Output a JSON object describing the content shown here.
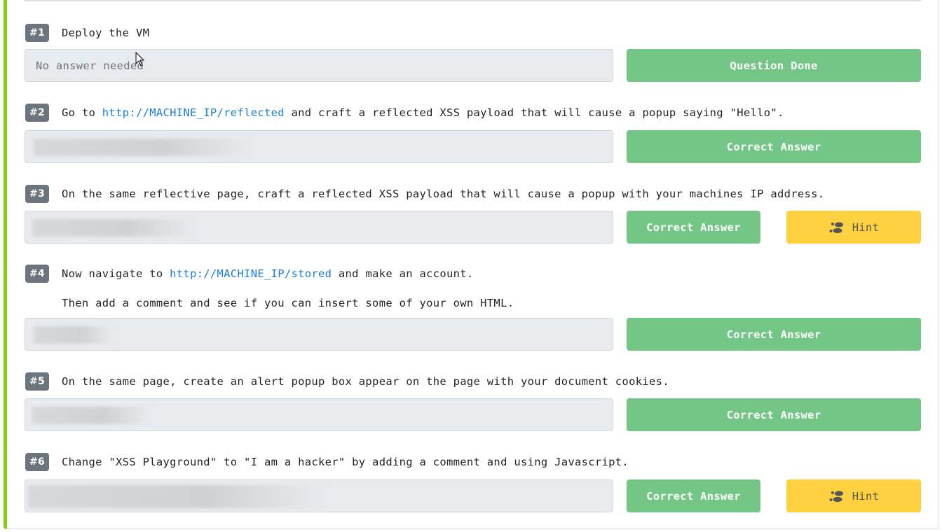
{
  "colors": {
    "accent_border": "#88cc14",
    "badge_bg": "#6c757d",
    "success": "#74c687",
    "hint": "#fdd13f",
    "link": "#1c7dd6",
    "field_bg": "#e7ebee"
  },
  "questions": [
    {
      "number": "#1",
      "text_before": "Deploy the VM",
      "answer": {
        "value": "No answer needed",
        "blurred": false
      },
      "submit_label": "Question Done",
      "hint_label": null
    },
    {
      "number": "#2",
      "text_before": "Go to ",
      "link": "http://MACHINE_IP/reflected",
      "text_after": " and craft a reflected XSS payload that will cause a popup saying \"Hello\".",
      "answer": {
        "value": "",
        "blurred": true
      },
      "submit_label": "Correct Answer",
      "hint_label": null
    },
    {
      "number": "#3",
      "text_before": "On the same reflective page, craft a reflected XSS payload that will cause a popup with your machines IP address.",
      "answer": {
        "value": "",
        "blurred": true
      },
      "submit_label": "Correct Answer",
      "hint_label": "Hint",
      "hint_icon": "footprints-icon"
    },
    {
      "number": "#4",
      "text_before": "Now navigate to ",
      "link": "http://MACHINE_IP/stored",
      "text_after": " and make an account.",
      "text_line2": "Then add a comment and see if you can insert some of your own HTML.",
      "answer": {
        "value": "",
        "blurred": true
      },
      "submit_label": "Correct Answer",
      "hint_label": null
    },
    {
      "number": "#5",
      "text_before": "On the same page, create an alert popup box appear on the page with your document cookies.",
      "answer": {
        "value": "",
        "blurred": true
      },
      "submit_label": "Correct Answer",
      "hint_label": null
    },
    {
      "number": "#6",
      "text_before": "Change \"XSS Playground\" to \"I am a hacker\" by adding a comment and using Javascript.",
      "answer": {
        "value": "",
        "blurred": true
      },
      "submit_label": "Correct Answer",
      "hint_label": "Hint",
      "hint_icon": "footprints-icon"
    }
  ]
}
